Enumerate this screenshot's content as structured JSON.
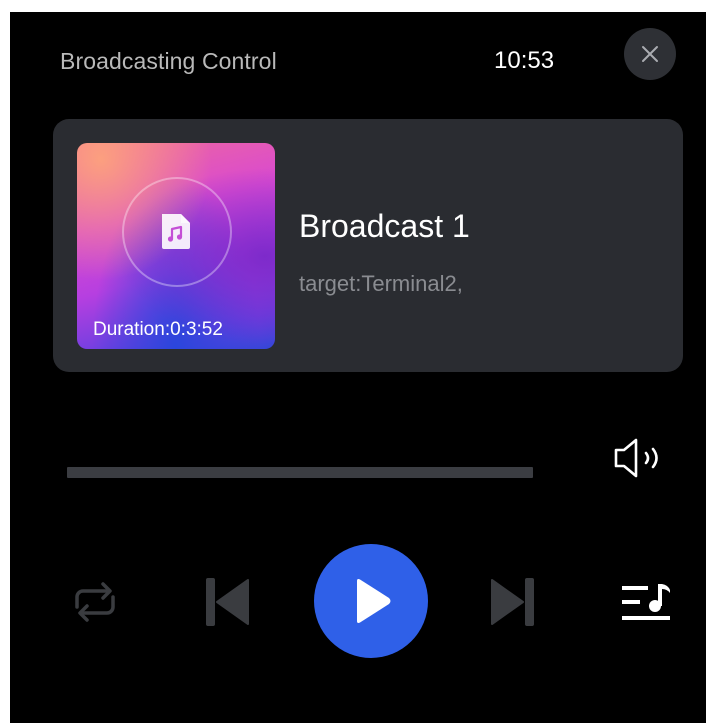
{
  "header": {
    "title": "Broadcasting Control",
    "time": "10:53"
  },
  "track": {
    "title": "Broadcast 1",
    "target": "target:Terminal2,",
    "duration": "Duration:0:3:52"
  },
  "progress": 0,
  "icons": {
    "close": "close-icon",
    "music_file": "music-file-icon",
    "volume": "volume-icon",
    "repeat": "repeat-icon",
    "previous": "previous-icon",
    "play": "play-icon",
    "next": "next-icon",
    "playlist": "playlist-icon"
  },
  "colors": {
    "background": "#000000",
    "card": "#2a2c31",
    "accent": "#2f60e8",
    "muted_text": "#b9b9b9",
    "disabled_icon": "#3a3c40"
  }
}
